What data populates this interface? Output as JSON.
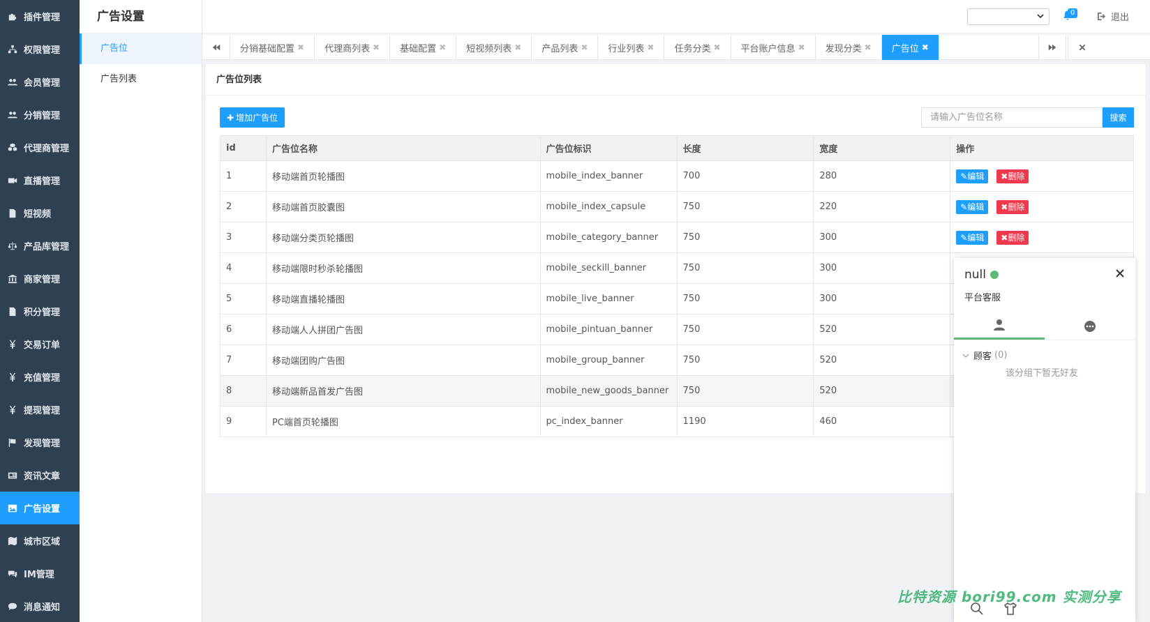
{
  "sidebar": {
    "items": [
      {
        "label": "插件管理",
        "icon": "puzzle-icon"
      },
      {
        "label": "权限管理",
        "icon": "sitemap-icon"
      },
      {
        "label": "会员管理",
        "icon": "users-icon"
      },
      {
        "label": "分销管理",
        "icon": "users-icon"
      },
      {
        "label": "代理商管理",
        "icon": "cubes-icon"
      },
      {
        "label": "直播管理",
        "icon": "video-camera-icon"
      },
      {
        "label": "短视频",
        "icon": "file-icon"
      },
      {
        "label": "产品库管理",
        "icon": "balance-scale-icon"
      },
      {
        "label": "商家管理",
        "icon": "bank-icon"
      },
      {
        "label": "积分管理",
        "icon": "file-text-icon"
      },
      {
        "label": "交易订单",
        "icon": "yen-icon"
      },
      {
        "label": "充值管理",
        "icon": "yen-icon"
      },
      {
        "label": "提现管理",
        "icon": "yen-icon"
      },
      {
        "label": "发现管理",
        "icon": "flag-icon"
      },
      {
        "label": "资讯文章",
        "icon": "newspaper-icon"
      },
      {
        "label": "广告设置",
        "icon": "image-icon",
        "active": true
      },
      {
        "label": "城市区域",
        "icon": "map-icon"
      },
      {
        "label": "IM管理",
        "icon": "comments-icon"
      },
      {
        "label": "消息通知",
        "icon": "commenting-icon"
      }
    ]
  },
  "subnav": {
    "title": "广告设置",
    "items": [
      {
        "label": "广告位",
        "active": true
      },
      {
        "label": "广告列表"
      }
    ]
  },
  "topbar": {
    "select_value": "",
    "badge_count": "0",
    "logout_label": "退出"
  },
  "tabs": [
    {
      "label": "分销基础配置"
    },
    {
      "label": "代理商列表"
    },
    {
      "label": "基础配置"
    },
    {
      "label": "短视频列表"
    },
    {
      "label": "产品列表"
    },
    {
      "label": "行业列表"
    },
    {
      "label": "任务分类"
    },
    {
      "label": "平台账户信息"
    },
    {
      "label": "发现分类"
    },
    {
      "label": "广告位",
      "active": true
    }
  ],
  "main": {
    "title": "广告位列表",
    "add_label": "增加广告位",
    "search_placeholder": "请输入广告位名称",
    "search_label": "搜索",
    "columns": [
      "id",
      "广告位名称",
      "广告位标识",
      "长度",
      "宽度",
      "操作"
    ],
    "edit_label": "编辑",
    "delete_label": "删除",
    "rows": [
      {
        "id": "1",
        "name": "移动端首页轮播图",
        "key": "mobile_index_banner",
        "length": "700",
        "width": "280"
      },
      {
        "id": "2",
        "name": "移动端首页胶囊图",
        "key": "mobile_index_capsule",
        "length": "750",
        "width": "220"
      },
      {
        "id": "3",
        "name": "移动端分类页轮播图",
        "key": "mobile_category_banner",
        "length": "750",
        "width": "300"
      },
      {
        "id": "4",
        "name": "移动端限时秒杀轮播图",
        "key": "mobile_seckill_banner",
        "length": "750",
        "width": "300"
      },
      {
        "id": "5",
        "name": "移动端直播轮播图",
        "key": "mobile_live_banner",
        "length": "750",
        "width": "300"
      },
      {
        "id": "6",
        "name": "移动端人人拼团广告图",
        "key": "mobile_pintuan_banner",
        "length": "750",
        "width": "520"
      },
      {
        "id": "7",
        "name": "移动端团购广告图",
        "key": "mobile_group_banner",
        "length": "750",
        "width": "520"
      },
      {
        "id": "8",
        "name": "移动端新品首发广告图",
        "key": "mobile_new_goods_banner",
        "length": "750",
        "width": "520"
      },
      {
        "id": "9",
        "name": "PC端首页轮播图",
        "key": "pc_index_banner",
        "length": "1190",
        "width": "460"
      }
    ]
  },
  "chat": {
    "name": "null",
    "subtitle": "平台客服",
    "group_label": "顾客",
    "group_count": "(0)",
    "empty_text": "该分组下暂无好友"
  },
  "watermark": "比特资源 bori99.com 实测分享",
  "colors": {
    "accent": "#1E9FFF",
    "sidebar_bg": "#2f4050",
    "danger": "#f0394b",
    "online": "#5FB878"
  }
}
